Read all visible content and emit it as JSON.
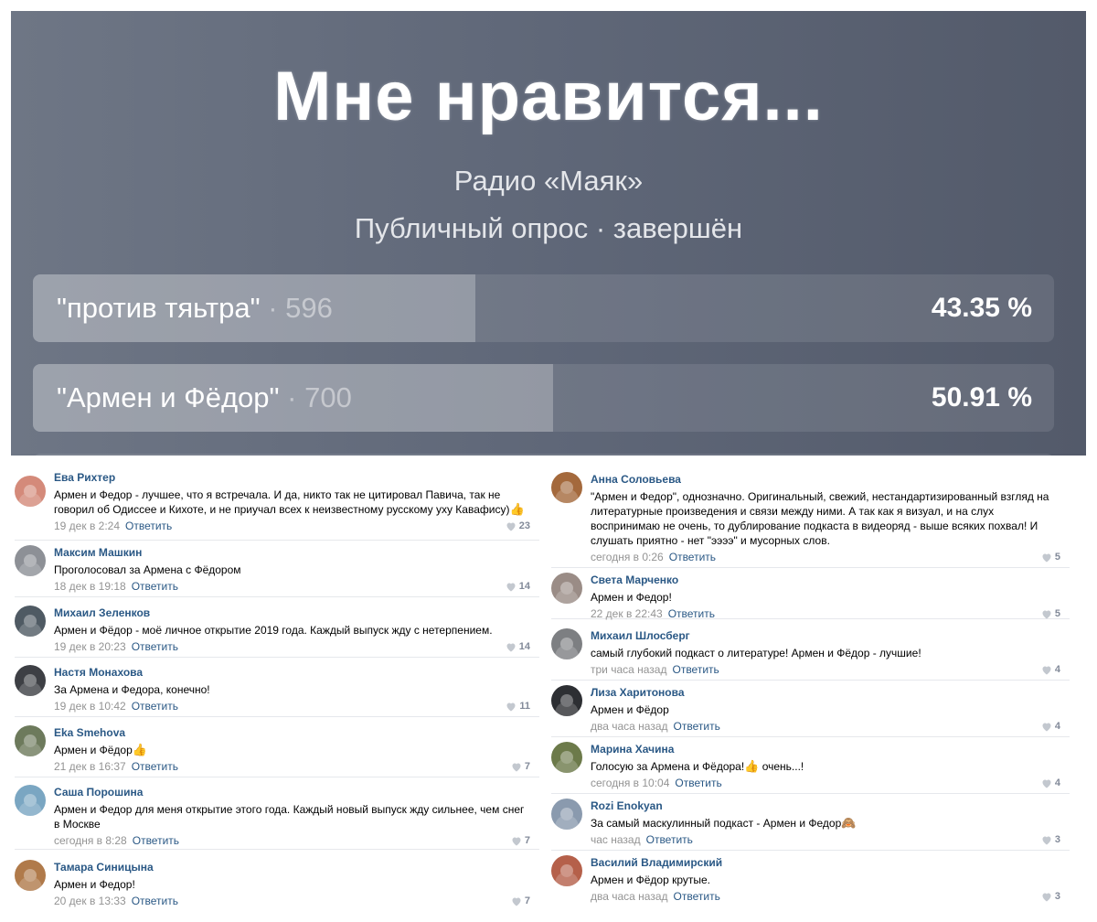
{
  "poll": {
    "title": "Мне нравится...",
    "author": "Радио «Маяк»",
    "status": "Публичный опрос · завершён",
    "options": [
      {
        "label": "\"против тяьтра\"",
        "count": "596",
        "percent_text": "43.35 %",
        "percent": 43.35
      },
      {
        "label": "\"Армен и Фёдор\"",
        "count": "700",
        "percent_text": "50.91 %",
        "percent": 50.91
      }
    ]
  },
  "comments_left": [
    {
      "author": "Ева Рихтер",
      "text": "Армен и Федор - лучшее, что я встречала. И да, никто так не цитировал Павича, так не говорил об Одиссее и Кихоте, и не приучал всех к неизвестному русскому уху Кавафису)",
      "emoji": "👍",
      "date": "19 дек в 2:24",
      "reply": "Ответить",
      "likes": "23",
      "avatar_color": "#d48a7a",
      "avatar_icon": "avatar-photo"
    },
    {
      "author": "Максим Машкин",
      "text": "Проголосовал за Армена с Фёдором",
      "emoji": "",
      "date": "18 дек в 19:18",
      "reply": "Ответить",
      "likes": "14",
      "avatar_color": "#8d9096",
      "avatar_icon": "avatar-photo"
    },
    {
      "author": "Михаил Зеленков",
      "text": "Армен и Фёдор - моё личное открытие 2019 года. Каждый выпуск жду с нетерпением.",
      "emoji": "",
      "date": "19 дек в 20:23",
      "reply": "Ответить",
      "likes": "14",
      "avatar_color": "#4f5a63",
      "avatar_icon": "avatar-photo"
    },
    {
      "author": "Настя Монахова",
      "text": "За Армена и Федора, конечно!",
      "emoji": "",
      "date": "19 дек в 10:42",
      "reply": "Ответить",
      "likes": "11",
      "avatar_color": "#3d3f44",
      "avatar_icon": "avatar-photo"
    },
    {
      "author": "Eka Smehova",
      "text": "Армен и Фёдор",
      "emoji": "👍",
      "date": "21 дек в 16:37",
      "reply": "Ответить",
      "likes": "7",
      "avatar_color": "#6d7a5c",
      "avatar_icon": "avatar-photo"
    },
    {
      "author": "Саша Порошина",
      "text": "Армен и Федор для меня открытие этого года. Каждый новый выпуск жду сильнее, чем снег в Москве",
      "emoji": "",
      "date": "сегодня в 8:28",
      "reply": "Ответить",
      "likes": "7",
      "avatar_color": "#7aa6c2",
      "avatar_icon": "avatar-photo"
    },
    {
      "author": "Тамара Синицына",
      "text": "Армен и Федор!",
      "emoji": "",
      "date": "20 дек в 13:33",
      "reply": "Ответить",
      "likes": "7",
      "avatar_color": "#b07a4a",
      "avatar_icon": "avatar-photo"
    }
  ],
  "comments_right": [
    {
      "author": "Анна Соловьева",
      "text": "\"Армен и Федор\", однозначно. Оригинальный, свежий, нестандартизированный взгляд на литературные произведения и связи между ними. А так как я визуал, и на слух воспринимаю не очень, то дублирование подкаста в видеоряд - выше всяких похвал! И слушать приятно - нет \"ээээ\" и мусорных слов.",
      "emoji": "",
      "date": "сегодня в 0:26",
      "reply": "Ответить",
      "likes": "5",
      "avatar_color": "#a4693c",
      "avatar_icon": "avatar-photo"
    },
    {
      "author": "Света Марченко",
      "text": "Армен и Федор!",
      "emoji": "",
      "date": "22 дек в 22:43",
      "reply": "Ответить",
      "likes": "5",
      "avatar_color": "#9a8c86",
      "avatar_icon": "avatar-photo"
    },
    {
      "author": "Михаил Шлосберг",
      "text": "самый глубокий подкаст о литературе! Армен и Фёдор - лучшие!",
      "emoji": "",
      "date": "три часа назад",
      "reply": "Ответить",
      "likes": "4",
      "avatar_color": "#7d7f82",
      "avatar_icon": "avatar-photo"
    },
    {
      "author": "Лиза Харитонова",
      "text": "Армен и Фёдор",
      "emoji": "",
      "date": "два часа назад",
      "reply": "Ответить",
      "likes": "4",
      "avatar_color": "#2d2f33",
      "avatar_icon": "avatar-photo"
    },
    {
      "author": "Марина Хачина",
      "text": "Голосую за Армена и Фёдора!",
      "emoji": "👍",
      "text_after": " очень...!",
      "date": "сегодня в 10:04",
      "reply": "Ответить",
      "likes": "4",
      "avatar_color": "#6c7a4a",
      "avatar_icon": "avatar-photo"
    },
    {
      "author": "Rozi Enokyan",
      "text": "За самый маскулинный подкаст - Армен и Федор",
      "emoji": "🙈",
      "date": "час назад",
      "reply": "Ответить",
      "likes": "3",
      "avatar_color": "#8a9aae",
      "avatar_icon": "avatar-photo"
    },
    {
      "author": "Василий Владимирский",
      "text": "Армен и Фёдор крутые.",
      "emoji": "",
      "date": "два часа назад",
      "reply": "Ответить",
      "likes": "3",
      "avatar_color": "#b5604a",
      "avatar_icon": "avatar-photo"
    }
  ],
  "colors": {
    "link": "#2a5885",
    "meta": "#939393",
    "poll_bg": "#5f6778"
  }
}
